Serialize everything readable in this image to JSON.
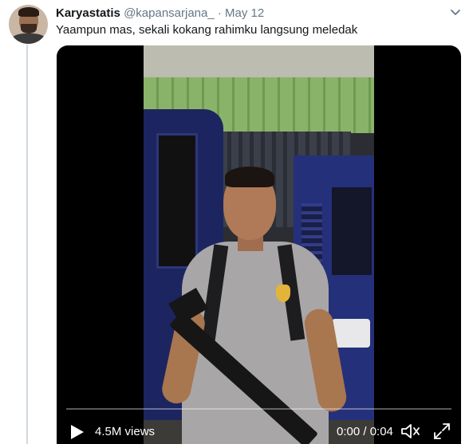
{
  "tweet": {
    "display_name": "Karyastatis",
    "handle": "@kapansarjana_",
    "separator": "·",
    "date": "May 12",
    "text": "Yaampun mas, sekali kokang rahimku langsung meledak"
  },
  "video": {
    "views": "4.5M views",
    "time": "0:00 / 0:04",
    "progress": 0.0
  },
  "icons": {
    "menu": "chevron-down-icon",
    "play": "play-icon",
    "volume": "volume-icon",
    "fullscreen": "fullscreen-icon"
  },
  "colors": {
    "text": "#14171a",
    "secondary_text": "#657786",
    "thread_line": "#cfd9de",
    "video_bg": "#000000",
    "controls": "#ffffff"
  }
}
